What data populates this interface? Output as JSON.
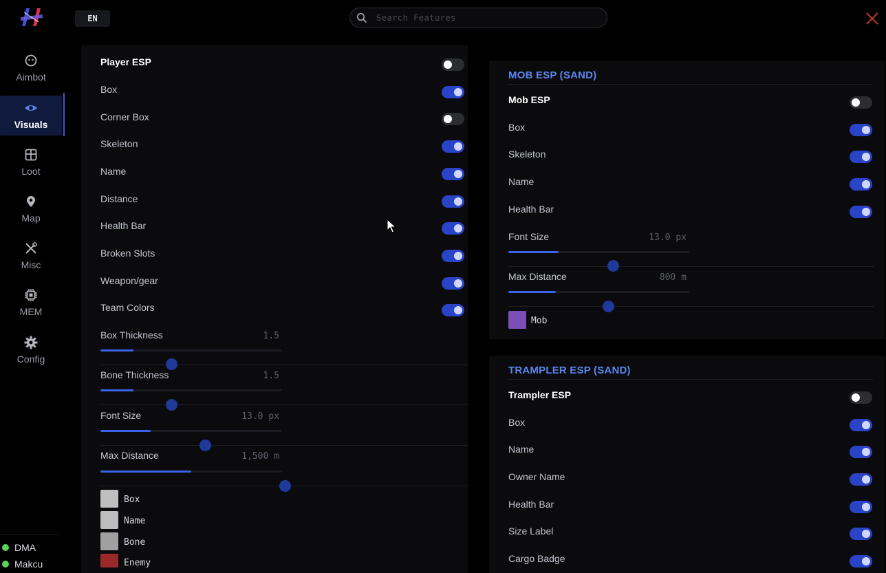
{
  "header": {
    "lang_label": "EN",
    "search_placeholder": "Search Features"
  },
  "colors": {
    "accent": "#3a63e8",
    "title_blue": "#5b86f0",
    "toggle_on": "#2a44c8",
    "close_red": "#c0392b",
    "status_green": "#5bd35a"
  },
  "sidebar": {
    "items": [
      {
        "label": "Aimbot",
        "icon": "crosshair-icon"
      },
      {
        "label": "Visuals",
        "icon": "eye-icon",
        "active": true
      },
      {
        "label": "Loot",
        "icon": "box-icon"
      },
      {
        "label": "Map",
        "icon": "map-pin-icon"
      },
      {
        "label": "Misc",
        "icon": "tools-icon"
      },
      {
        "label": "MEM",
        "icon": "chip-icon"
      },
      {
        "label": "Config",
        "icon": "gear-icon"
      }
    ],
    "status": [
      {
        "label": "DMA"
      },
      {
        "label": "Makcu"
      }
    ]
  },
  "player_esp": {
    "toggles": [
      {
        "label": "Player ESP",
        "on": false
      },
      {
        "label": "Box",
        "on": true
      },
      {
        "label": "Corner Box",
        "on": false
      },
      {
        "label": "Skeleton",
        "on": true
      },
      {
        "label": "Name",
        "on": true
      },
      {
        "label": "Distance",
        "on": true
      },
      {
        "label": "Health Bar",
        "on": true
      },
      {
        "label": "Broken Slots",
        "on": true
      },
      {
        "label": "Weapon/gear",
        "on": true
      },
      {
        "label": "Team Colors",
        "on": true
      }
    ],
    "sliders": [
      {
        "label": "Box Thickness",
        "value": "1.5"
      },
      {
        "label": "Bone Thickness",
        "value": "1.5"
      },
      {
        "label": "Font Size",
        "value": "13.0 px"
      },
      {
        "label": "Max Distance",
        "value": "1,500 m"
      }
    ],
    "colors": [
      {
        "label": "Box",
        "color": "#bfbfbf"
      },
      {
        "label": "Name",
        "color": "#bdbdbd"
      },
      {
        "label": "Bone",
        "color": "#a0a0a0"
      },
      {
        "label": "Enemy",
        "color": "#9a2a2a"
      }
    ]
  },
  "mob_esp": {
    "title": "MOB ESP (SAND)",
    "toggles": [
      {
        "label": "Mob ESP",
        "on": false
      },
      {
        "label": "Box",
        "on": true
      },
      {
        "label": "Skeleton",
        "on": true
      },
      {
        "label": "Name",
        "on": true
      },
      {
        "label": "Health Bar",
        "on": true
      }
    ],
    "sliders": [
      {
        "label": "Font Size",
        "value": "13.0 px"
      },
      {
        "label": "Max Distance",
        "value": "800 m"
      }
    ],
    "colors": [
      {
        "label": "Mob",
        "color": "#7b4fb5"
      }
    ]
  },
  "trampler_esp": {
    "title": "TRAMPLER ESP (SAND)",
    "toggles": [
      {
        "label": "Trampler ESP",
        "on": false
      },
      {
        "label": "Box",
        "on": true
      },
      {
        "label": "Name",
        "on": true
      },
      {
        "label": "Owner Name",
        "on": true
      },
      {
        "label": "Health Bar",
        "on": true
      },
      {
        "label": "Size Label",
        "on": true
      },
      {
        "label": "Cargo Badge",
        "on": true
      }
    ]
  }
}
